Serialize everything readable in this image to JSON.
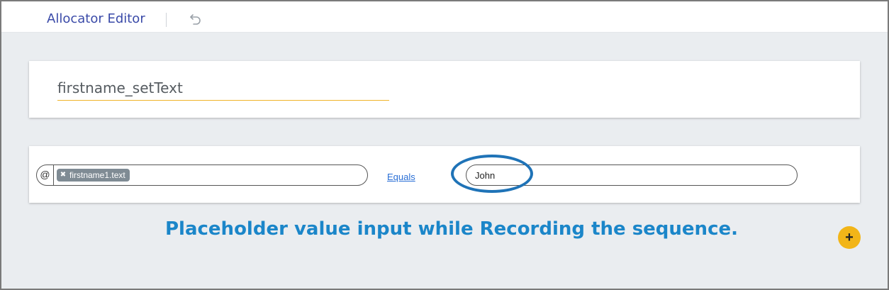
{
  "header": {
    "title": "Allocator Editor",
    "undo_icon": "undo-icon"
  },
  "name_card": {
    "value": "firstname_setText"
  },
  "condition": {
    "lhs_prefix": "@",
    "lhs_chip": "firstname1.text",
    "operator": "Equals",
    "rhs_value": "John"
  },
  "annotation": {
    "text": "Placeholder value input while Recording the sequence."
  },
  "add_button": {
    "label": "+"
  },
  "colors": {
    "accent": "#3a4aa8",
    "underline": "#f0b429",
    "annotation": "#1b86c9",
    "add_button": "#f2b518"
  }
}
